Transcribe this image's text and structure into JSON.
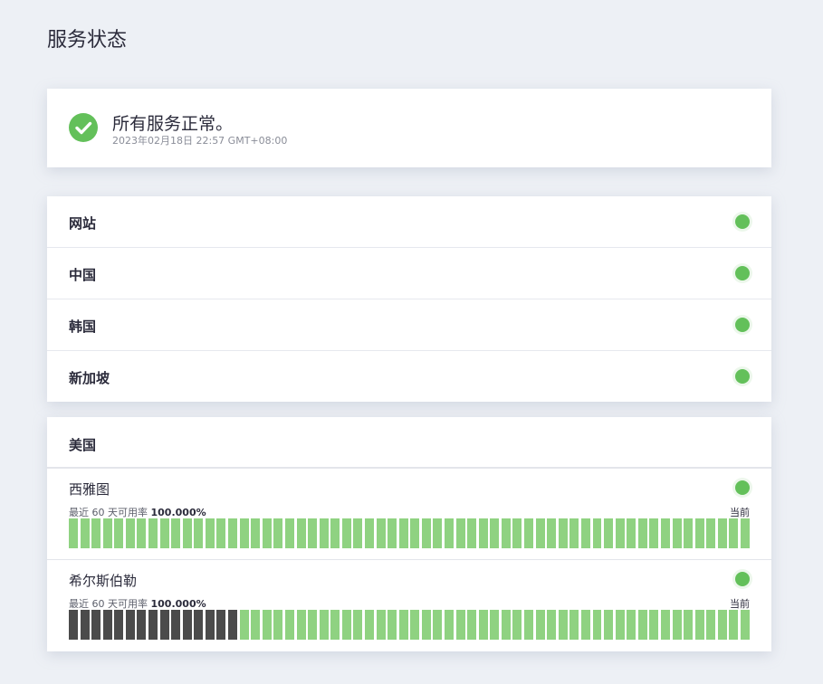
{
  "page": {
    "title": "服务状态"
  },
  "overall": {
    "message": "所有服务正常。",
    "timestamp": "2023年02月18日 22:57 GMT+08:00",
    "icon": "check-circle-icon",
    "status_color": "#63c05a"
  },
  "regions": [
    {
      "label": "网站",
      "status": "up"
    },
    {
      "label": "中国",
      "status": "up"
    },
    {
      "label": "韩国",
      "status": "up"
    },
    {
      "label": "新加坡",
      "status": "up"
    }
  ],
  "usa": {
    "label": "美国",
    "sites": [
      {
        "name": "西雅图",
        "uptime_prefix": "最近 60 天可用率",
        "uptime_value": "100.000%",
        "current_label": "当前",
        "days": [
          "up",
          "up",
          "up",
          "up",
          "up",
          "up",
          "up",
          "up",
          "up",
          "up",
          "up",
          "up",
          "up",
          "up",
          "up",
          "up",
          "up",
          "up",
          "up",
          "up",
          "up",
          "up",
          "up",
          "up",
          "up",
          "up",
          "up",
          "up",
          "up",
          "up",
          "up",
          "up",
          "up",
          "up",
          "up",
          "up",
          "up",
          "up",
          "up",
          "up",
          "up",
          "up",
          "up",
          "up",
          "up",
          "up",
          "up",
          "up",
          "up",
          "up",
          "up",
          "up",
          "up",
          "up",
          "up",
          "up",
          "up",
          "up",
          "up",
          "up"
        ]
      },
      {
        "name": "希尔斯伯勒",
        "uptime_prefix": "最近 60 天可用率",
        "uptime_value": "100.000%",
        "current_label": "当前",
        "days": [
          "none",
          "none",
          "none",
          "none",
          "none",
          "none",
          "none",
          "none",
          "none",
          "none",
          "none",
          "none",
          "none",
          "none",
          "none",
          "up",
          "up",
          "up",
          "up",
          "up",
          "up",
          "up",
          "up",
          "up",
          "up",
          "up",
          "up",
          "up",
          "up",
          "up",
          "up",
          "up",
          "up",
          "up",
          "up",
          "up",
          "up",
          "up",
          "up",
          "up",
          "up",
          "up",
          "up",
          "up",
          "up",
          "up",
          "up",
          "up",
          "up",
          "up",
          "up",
          "up",
          "up",
          "up",
          "up",
          "up",
          "up",
          "up",
          "up",
          "up"
        ]
      }
    ]
  },
  "colors": {
    "up": "#8fd281",
    "none": "#4b4b4b",
    "dot": "#63c05a"
  }
}
